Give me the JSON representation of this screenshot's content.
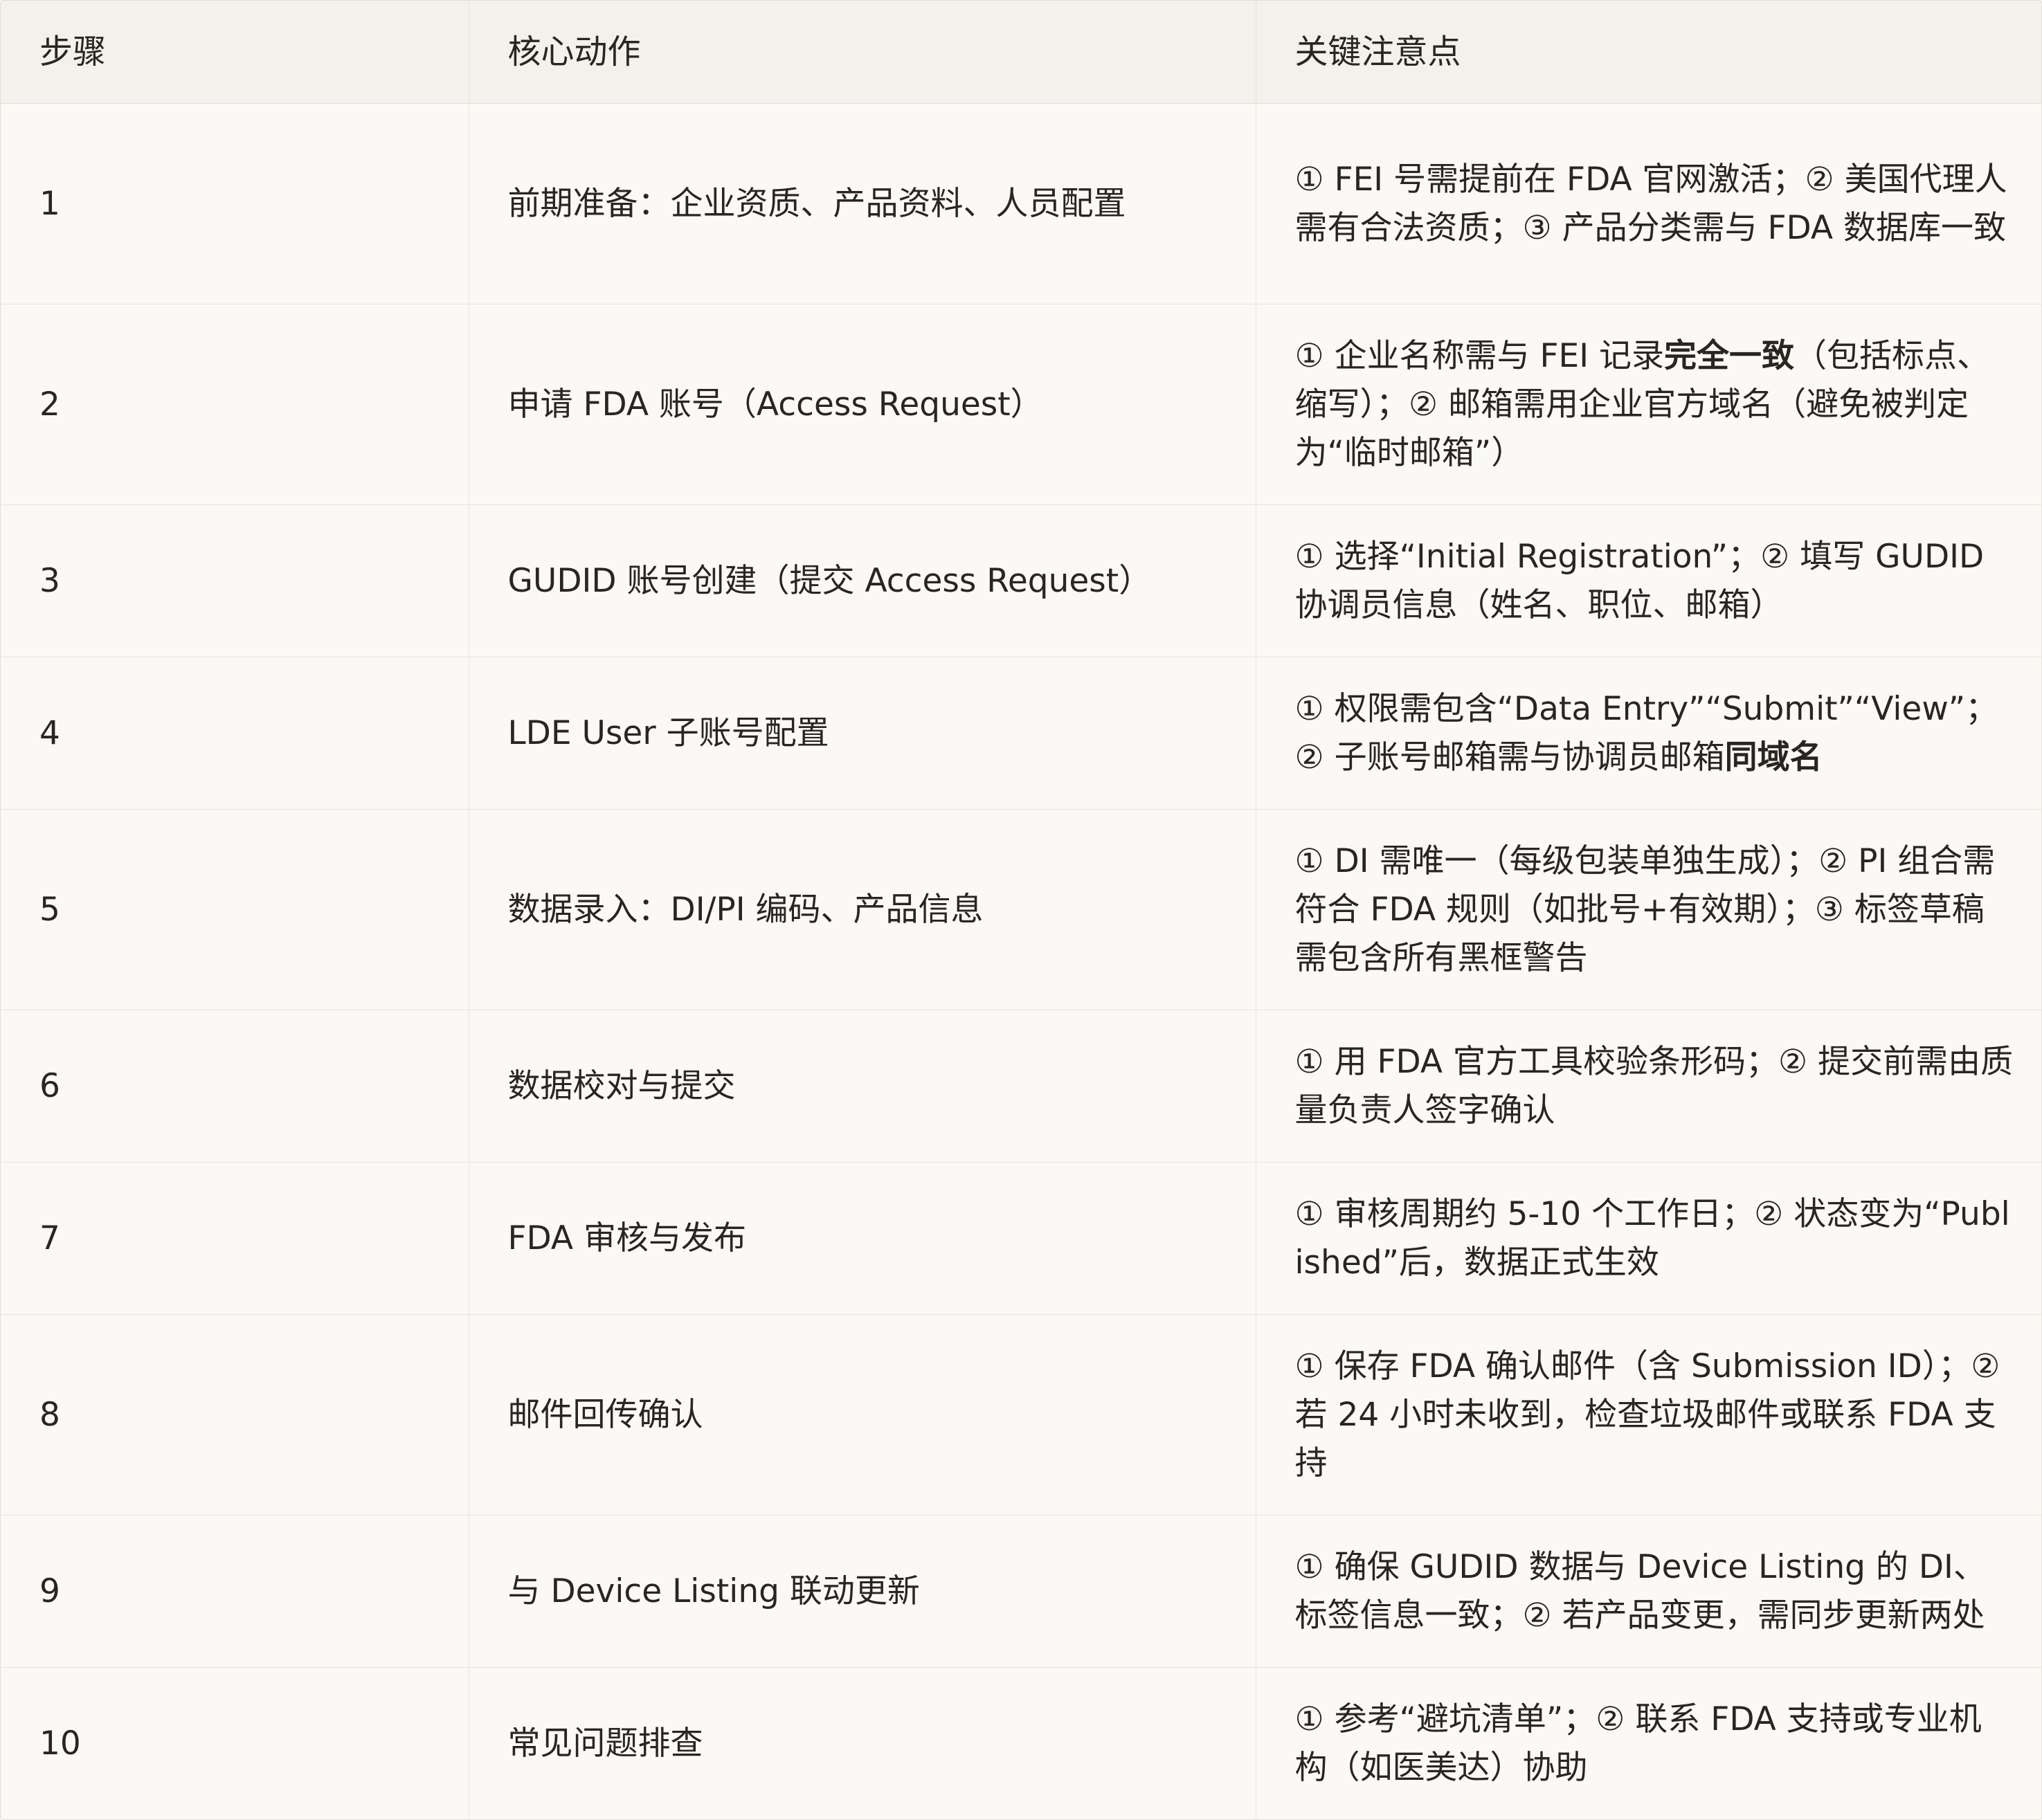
{
  "table": {
    "headers": [
      "步骤",
      "核心动作",
      "关键注意点"
    ],
    "rows": [
      {
        "step": "1",
        "action": "前期准备：企业资质、产品资料、人员配置",
        "notes": [
          {
            "text": "① FEI 号需提前在 FDA 官网激活；② 美国代理人需有合法资质；③ 产品分类需与 FDA 数据库一致",
            "bold": false
          }
        ]
      },
      {
        "step": "2",
        "action": "申请 FDA 账号（Access Request）",
        "notes": [
          {
            "text": "① 企业名称需与 FEI 记录",
            "bold": false
          },
          {
            "text": "完全一致",
            "bold": true
          },
          {
            "text": "（包括标点、缩写）；② 邮箱需用企业官方域名（避免被判定为“临时邮箱”）",
            "bold": false
          }
        ]
      },
      {
        "step": "3",
        "action": "GUDID 账号创建（提交 Access Request）",
        "notes": [
          {
            "text": "① 选择“Initial Registration”；② 填写 GUDID 协调员信息（姓名、职位、邮箱）",
            "bold": false
          }
        ]
      },
      {
        "step": "4",
        "action": "LDE User 子账号配置",
        "notes": [
          {
            "text": "① 权限需包含“Data Entry”“Submit”“View”；② 子账号邮箱需与协调员邮箱",
            "bold": false
          },
          {
            "text": "同域名",
            "bold": true
          }
        ]
      },
      {
        "step": "5",
        "action": "数据录入：DI/PI 编码、产品信息",
        "notes": [
          {
            "text": "① DI 需唯一（每级包装单独生成）；② PI 组合需符合 FDA 规则（如批号+有效期）；③ 标签草稿需包含所有黑框警告",
            "bold": false
          }
        ]
      },
      {
        "step": "6",
        "action": "数据校对与提交",
        "notes": [
          {
            "text": "① 用 FDA 官方工具校验条形码；② 提交前需由质量负责人签字确认",
            "bold": false
          }
        ]
      },
      {
        "step": "7",
        "action": "FDA 审核与发布",
        "notes": [
          {
            "text": "① 审核周期约 5-10 个工作日；② 状态变为“Published”后，数据正式生效",
            "bold": false
          }
        ]
      },
      {
        "step": "8",
        "action": "邮件回传确认",
        "notes": [
          {
            "text": "① 保存 FDA 确认邮件（含 Submission ID）；② 若 24 小时未收到，检查垃圾邮件或联系 FDA 支持",
            "bold": false
          }
        ]
      },
      {
        "step": "9",
        "action": "与 Device Listing 联动更新",
        "notes": [
          {
            "text": "① 确保 GUDID 数据与 Device Listing 的 DI、标签信息一致；② 若产品变更，需同步更新两处",
            "bold": false
          }
        ]
      },
      {
        "step": "10",
        "action": "常见问题排查",
        "notes": [
          {
            "text": "① 参考“避坑清单”；② 联系 FDA 支持或专业机构（如医美达）协助",
            "bold": false
          }
        ]
      }
    ],
    "row_line_counts": [
      3,
      3,
      2,
      2,
      3,
      2,
      2,
      3,
      2,
      2
    ]
  }
}
